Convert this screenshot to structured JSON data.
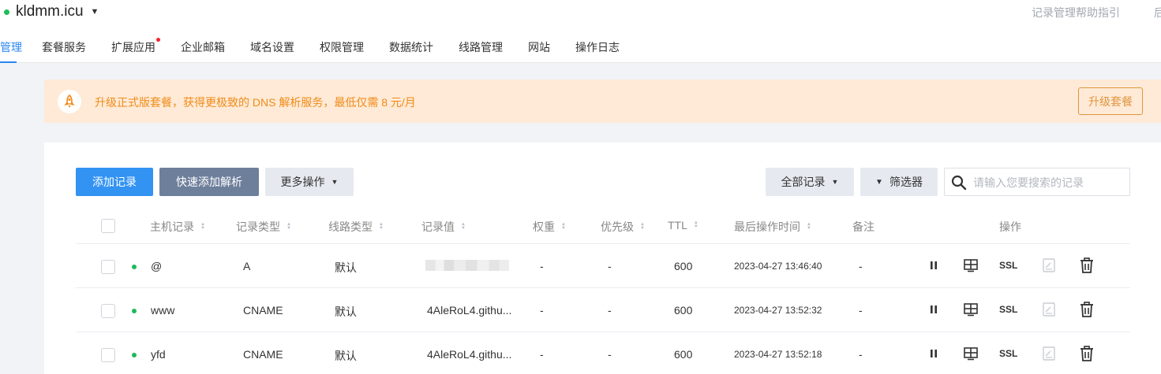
{
  "header": {
    "domain": "kldmm.icu",
    "help_link": "记录管理帮助指引",
    "help_link_cut": "后"
  },
  "nav": {
    "active_tab": "管理",
    "tabs": [
      "套餐服务",
      "扩展应用",
      "企业邮箱",
      "域名设置",
      "权限管理",
      "数据统计",
      "线路管理",
      "网站",
      "操作日志"
    ]
  },
  "banner": {
    "text": "升级正式版套餐，获得更极致的 DNS 解析服务，最低仅需 8 元/月",
    "button": "升级套餐"
  },
  "toolbar": {
    "add_record": "添加记录",
    "quick_add": "快速添加解析",
    "more_ops": "更多操作",
    "all_records": "全部记录",
    "filter": "筛选器",
    "search_placeholder": "请输入您要搜索的记录"
  },
  "table": {
    "headers": [
      "主机记录",
      "记录类型",
      "线路类型",
      "记录值",
      "权重",
      "优先级",
      "TTL",
      "最后操作时间",
      "备注",
      "操作"
    ],
    "rows": [
      {
        "host": "@",
        "type": "A",
        "line": "默认",
        "value": "",
        "weight": "-",
        "priority": "-",
        "ttl": "600",
        "time": "2023-04-27 13:46:40",
        "remark": "-",
        "ssl": "SSL"
      },
      {
        "host": "www",
        "type": "CNAME",
        "line": "默认",
        "value": "4AleRoL4.githu...",
        "weight": "-",
        "priority": "-",
        "ttl": "600",
        "time": "2023-04-27 13:52:32",
        "remark": "-",
        "ssl": "SSL"
      },
      {
        "host": "yfd",
        "type": "CNAME",
        "line": "默认",
        "value": "4AleRoL4.githu...",
        "weight": "-",
        "priority": "-",
        "ttl": "600",
        "time": "2023-04-27 13:52:18",
        "remark": "-",
        "ssl": "SSL"
      }
    ]
  },
  "colors": {
    "accent": "#2a86f2",
    "status_green": "#1fb95c",
    "banner_bg": "#feead6",
    "banner_text": "#f18b18"
  }
}
